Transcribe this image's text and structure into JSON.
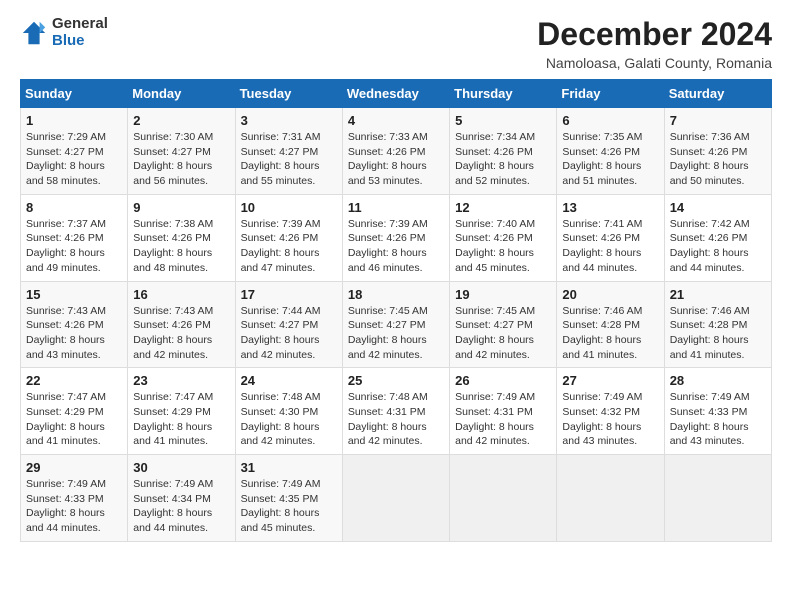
{
  "header": {
    "logo": {
      "general": "General",
      "blue": "Blue"
    },
    "title": "December 2024",
    "subtitle": "Namoloasa, Galati County, Romania"
  },
  "days_of_week": [
    "Sunday",
    "Monday",
    "Tuesday",
    "Wednesday",
    "Thursday",
    "Friday",
    "Saturday"
  ],
  "weeks": [
    [
      {
        "day": "1",
        "sunrise": "Sunrise: 7:29 AM",
        "sunset": "Sunset: 4:27 PM",
        "daylight": "Daylight: 8 hours and 58 minutes."
      },
      {
        "day": "2",
        "sunrise": "Sunrise: 7:30 AM",
        "sunset": "Sunset: 4:27 PM",
        "daylight": "Daylight: 8 hours and 56 minutes."
      },
      {
        "day": "3",
        "sunrise": "Sunrise: 7:31 AM",
        "sunset": "Sunset: 4:27 PM",
        "daylight": "Daylight: 8 hours and 55 minutes."
      },
      {
        "day": "4",
        "sunrise": "Sunrise: 7:33 AM",
        "sunset": "Sunset: 4:26 PM",
        "daylight": "Daylight: 8 hours and 53 minutes."
      },
      {
        "day": "5",
        "sunrise": "Sunrise: 7:34 AM",
        "sunset": "Sunset: 4:26 PM",
        "daylight": "Daylight: 8 hours and 52 minutes."
      },
      {
        "day": "6",
        "sunrise": "Sunrise: 7:35 AM",
        "sunset": "Sunset: 4:26 PM",
        "daylight": "Daylight: 8 hours and 51 minutes."
      },
      {
        "day": "7",
        "sunrise": "Sunrise: 7:36 AM",
        "sunset": "Sunset: 4:26 PM",
        "daylight": "Daylight: 8 hours and 50 minutes."
      }
    ],
    [
      {
        "day": "8",
        "sunrise": "Sunrise: 7:37 AM",
        "sunset": "Sunset: 4:26 PM",
        "daylight": "Daylight: 8 hours and 49 minutes."
      },
      {
        "day": "9",
        "sunrise": "Sunrise: 7:38 AM",
        "sunset": "Sunset: 4:26 PM",
        "daylight": "Daylight: 8 hours and 48 minutes."
      },
      {
        "day": "10",
        "sunrise": "Sunrise: 7:39 AM",
        "sunset": "Sunset: 4:26 PM",
        "daylight": "Daylight: 8 hours and 47 minutes."
      },
      {
        "day": "11",
        "sunrise": "Sunrise: 7:39 AM",
        "sunset": "Sunset: 4:26 PM",
        "daylight": "Daylight: 8 hours and 46 minutes."
      },
      {
        "day": "12",
        "sunrise": "Sunrise: 7:40 AM",
        "sunset": "Sunset: 4:26 PM",
        "daylight": "Daylight: 8 hours and 45 minutes."
      },
      {
        "day": "13",
        "sunrise": "Sunrise: 7:41 AM",
        "sunset": "Sunset: 4:26 PM",
        "daylight": "Daylight: 8 hours and 44 minutes."
      },
      {
        "day": "14",
        "sunrise": "Sunrise: 7:42 AM",
        "sunset": "Sunset: 4:26 PM",
        "daylight": "Daylight: 8 hours and 44 minutes."
      }
    ],
    [
      {
        "day": "15",
        "sunrise": "Sunrise: 7:43 AM",
        "sunset": "Sunset: 4:26 PM",
        "daylight": "Daylight: 8 hours and 43 minutes."
      },
      {
        "day": "16",
        "sunrise": "Sunrise: 7:43 AM",
        "sunset": "Sunset: 4:26 PM",
        "daylight": "Daylight: 8 hours and 42 minutes."
      },
      {
        "day": "17",
        "sunrise": "Sunrise: 7:44 AM",
        "sunset": "Sunset: 4:27 PM",
        "daylight": "Daylight: 8 hours and 42 minutes."
      },
      {
        "day": "18",
        "sunrise": "Sunrise: 7:45 AM",
        "sunset": "Sunset: 4:27 PM",
        "daylight": "Daylight: 8 hours and 42 minutes."
      },
      {
        "day": "19",
        "sunrise": "Sunrise: 7:45 AM",
        "sunset": "Sunset: 4:27 PM",
        "daylight": "Daylight: 8 hours and 42 minutes."
      },
      {
        "day": "20",
        "sunrise": "Sunrise: 7:46 AM",
        "sunset": "Sunset: 4:28 PM",
        "daylight": "Daylight: 8 hours and 41 minutes."
      },
      {
        "day": "21",
        "sunrise": "Sunrise: 7:46 AM",
        "sunset": "Sunset: 4:28 PM",
        "daylight": "Daylight: 8 hours and 41 minutes."
      }
    ],
    [
      {
        "day": "22",
        "sunrise": "Sunrise: 7:47 AM",
        "sunset": "Sunset: 4:29 PM",
        "daylight": "Daylight: 8 hours and 41 minutes."
      },
      {
        "day": "23",
        "sunrise": "Sunrise: 7:47 AM",
        "sunset": "Sunset: 4:29 PM",
        "daylight": "Daylight: 8 hours and 41 minutes."
      },
      {
        "day": "24",
        "sunrise": "Sunrise: 7:48 AM",
        "sunset": "Sunset: 4:30 PM",
        "daylight": "Daylight: 8 hours and 42 minutes."
      },
      {
        "day": "25",
        "sunrise": "Sunrise: 7:48 AM",
        "sunset": "Sunset: 4:31 PM",
        "daylight": "Daylight: 8 hours and 42 minutes."
      },
      {
        "day": "26",
        "sunrise": "Sunrise: 7:49 AM",
        "sunset": "Sunset: 4:31 PM",
        "daylight": "Daylight: 8 hours and 42 minutes."
      },
      {
        "day": "27",
        "sunrise": "Sunrise: 7:49 AM",
        "sunset": "Sunset: 4:32 PM",
        "daylight": "Daylight: 8 hours and 43 minutes."
      },
      {
        "day": "28",
        "sunrise": "Sunrise: 7:49 AM",
        "sunset": "Sunset: 4:33 PM",
        "daylight": "Daylight: 8 hours and 43 minutes."
      }
    ],
    [
      {
        "day": "29",
        "sunrise": "Sunrise: 7:49 AM",
        "sunset": "Sunset: 4:33 PM",
        "daylight": "Daylight: 8 hours and 44 minutes."
      },
      {
        "day": "30",
        "sunrise": "Sunrise: 7:49 AM",
        "sunset": "Sunset: 4:34 PM",
        "daylight": "Daylight: 8 hours and 44 minutes."
      },
      {
        "day": "31",
        "sunrise": "Sunrise: 7:49 AM",
        "sunset": "Sunset: 4:35 PM",
        "daylight": "Daylight: 8 hours and 45 minutes."
      },
      null,
      null,
      null,
      null
    ]
  ]
}
